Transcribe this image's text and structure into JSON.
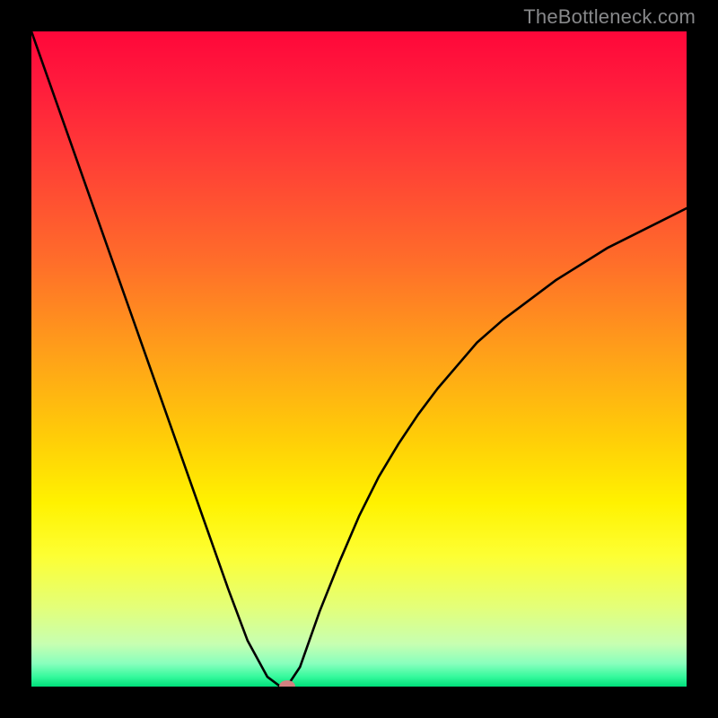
{
  "watermark": "TheBottleneck.com",
  "chart_data": {
    "type": "line",
    "title": "",
    "xlabel": "",
    "ylabel": "",
    "xlim": [
      0,
      100
    ],
    "ylim": [
      0,
      100
    ],
    "grid": false,
    "x": [
      0,
      3,
      6,
      9,
      12,
      15,
      18,
      21,
      24,
      27,
      30,
      33,
      36,
      38,
      39,
      41,
      44,
      47,
      50,
      53,
      56,
      59,
      62,
      65,
      68,
      72,
      76,
      80,
      84,
      88,
      92,
      96,
      100
    ],
    "values": [
      100,
      91.5,
      83,
      74.5,
      66,
      57.5,
      49,
      40.5,
      32,
      23.5,
      15,
      7,
      1.5,
      0,
      0,
      3,
      11.5,
      19,
      26,
      32,
      37,
      41.5,
      45.5,
      49,
      52.5,
      56,
      59,
      62,
      64.5,
      67,
      69,
      71,
      73
    ],
    "marker": {
      "x": 39,
      "y": 0,
      "color": "#d28080"
    },
    "gradient_stops": [
      {
        "offset": 0,
        "color": "#ff073a"
      },
      {
        "offset": 0.08,
        "color": "#ff1b3c"
      },
      {
        "offset": 0.2,
        "color": "#ff3f36"
      },
      {
        "offset": 0.35,
        "color": "#ff6d2a"
      },
      {
        "offset": 0.5,
        "color": "#ffa318"
      },
      {
        "offset": 0.62,
        "color": "#ffcd08"
      },
      {
        "offset": 0.72,
        "color": "#fff200"
      },
      {
        "offset": 0.8,
        "color": "#fdff33"
      },
      {
        "offset": 0.88,
        "color": "#e3ff7a"
      },
      {
        "offset": 0.935,
        "color": "#c7ffb1"
      },
      {
        "offset": 0.965,
        "color": "#88ffbd"
      },
      {
        "offset": 0.985,
        "color": "#35f99c"
      },
      {
        "offset": 1.0,
        "color": "#00de7a"
      }
    ],
    "curve_color": "#000000",
    "curve_width": 2.6
  }
}
